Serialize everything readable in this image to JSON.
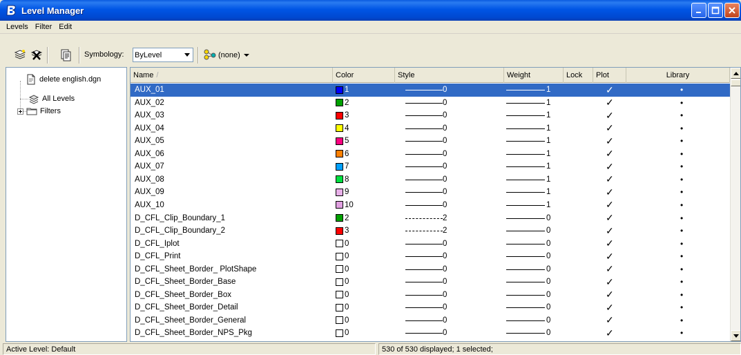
{
  "window": {
    "title": "Level Manager"
  },
  "menu": [
    "Levels",
    "Filter",
    "Edit"
  ],
  "toolbar": {
    "symbology_label": "Symbology:",
    "symbology_value": "ByLevel",
    "filter_value": "(none)"
  },
  "tree": {
    "items": [
      {
        "label": "delete english.dgn",
        "icon": "file-icon"
      },
      {
        "label": "All Levels",
        "icon": "levels-icon"
      },
      {
        "label": "Filters",
        "icon": "folder-icon"
      }
    ]
  },
  "table": {
    "headers": [
      "Name",
      "Color",
      "Style",
      "Weight",
      "Lock",
      "Plot",
      "Library"
    ],
    "rows": [
      {
        "name": "AUX_01",
        "color_hex": "#0000ff",
        "color": "1",
        "style_type": "solid",
        "style": "0",
        "weight": "1",
        "plot": "✓",
        "library": "•"
      },
      {
        "name": "AUX_02",
        "color_hex": "#00a000",
        "color": "2",
        "style_type": "solid",
        "style": "0",
        "weight": "1",
        "plot": "✓",
        "library": "•"
      },
      {
        "name": "AUX_03",
        "color_hex": "#ff0000",
        "color": "3",
        "style_type": "solid",
        "style": "0",
        "weight": "1",
        "plot": "✓",
        "library": "•"
      },
      {
        "name": "AUX_04",
        "color_hex": "#ffff00",
        "color": "4",
        "style_type": "solid",
        "style": "0",
        "weight": "1",
        "plot": "✓",
        "library": "•"
      },
      {
        "name": "AUX_05",
        "color_hex": "#ff0080",
        "color": "5",
        "style_type": "solid",
        "style": "0",
        "weight": "1",
        "plot": "✓",
        "library": "•"
      },
      {
        "name": "AUX_06",
        "color_hex": "#ff8000",
        "color": "6",
        "style_type": "solid",
        "style": "0",
        "weight": "1",
        "plot": "✓",
        "library": "•"
      },
      {
        "name": "AUX_07",
        "color_hex": "#00a0ff",
        "color": "7",
        "style_type": "solid",
        "style": "0",
        "weight": "1",
        "plot": "✓",
        "library": "•"
      },
      {
        "name": "AUX_08",
        "color_hex": "#00e040",
        "color": "8",
        "style_type": "solid",
        "style": "0",
        "weight": "1",
        "plot": "✓",
        "library": "•"
      },
      {
        "name": "AUX_09",
        "color_hex": "#e8b0e8",
        "color": "9",
        "style_type": "solid",
        "style": "0",
        "weight": "1",
        "plot": "✓",
        "library": "•"
      },
      {
        "name": "AUX_10",
        "color_hex": "#e0a0e0",
        "color": "10",
        "style_type": "solid",
        "style": "0",
        "weight": "1",
        "plot": "✓",
        "library": "•"
      },
      {
        "name": "D_CFL_Clip_Boundary_1",
        "color_hex": "#00a000",
        "color": "2",
        "style_type": "dashed",
        "style": "2",
        "weight": "0",
        "plot": "✓",
        "library": "•"
      },
      {
        "name": "D_CFL_Clip_Boundary_2",
        "color_hex": "#ff0000",
        "color": "3",
        "style_type": "dashed",
        "style": "2",
        "weight": "0",
        "plot": "✓",
        "library": "•"
      },
      {
        "name": "D_CFL_Iplot",
        "color_hex": "#ffffff",
        "color": "0",
        "style_type": "solid",
        "style": "0",
        "weight": "0",
        "plot": "✓",
        "library": "•"
      },
      {
        "name": "D_CFL_Print",
        "color_hex": "#ffffff",
        "color": "0",
        "style_type": "solid",
        "style": "0",
        "weight": "0",
        "plot": "✓",
        "library": "•"
      },
      {
        "name": "D_CFL_Sheet_Border_ PlotShape",
        "color_hex": "#ffffff",
        "color": "0",
        "style_type": "solid",
        "style": "0",
        "weight": "0",
        "plot": "✓",
        "library": "•"
      },
      {
        "name": "D_CFL_Sheet_Border_Base",
        "color_hex": "#ffffff",
        "color": "0",
        "style_type": "solid",
        "style": "0",
        "weight": "0",
        "plot": "✓",
        "library": "•"
      },
      {
        "name": "D_CFL_Sheet_Border_Box",
        "color_hex": "#ffffff",
        "color": "0",
        "style_type": "solid",
        "style": "0",
        "weight": "0",
        "plot": "✓",
        "library": "•"
      },
      {
        "name": "D_CFL_Sheet_Border_Detail",
        "color_hex": "#ffffff",
        "color": "0",
        "style_type": "solid",
        "style": "0",
        "weight": "0",
        "plot": "✓",
        "library": "•"
      },
      {
        "name": "D_CFL_Sheet_Border_General",
        "color_hex": "#ffffff",
        "color": "0",
        "style_type": "solid",
        "style": "0",
        "weight": "0",
        "plot": "✓",
        "library": "•"
      },
      {
        "name": "D_CFL_Sheet_Border_NPS_Pkg",
        "color_hex": "#ffffff",
        "color": "0",
        "style_type": "solid",
        "style": "0",
        "weight": "0",
        "plot": "✓",
        "library": "•"
      }
    ]
  },
  "status": {
    "active_level": "Active Level: Default",
    "display_count": "530 of 530 displayed; 1 selected;"
  },
  "colors": {
    "titlebar": "#0055e5",
    "selection": "#316ac5",
    "window_bg": "#ece9d8"
  }
}
